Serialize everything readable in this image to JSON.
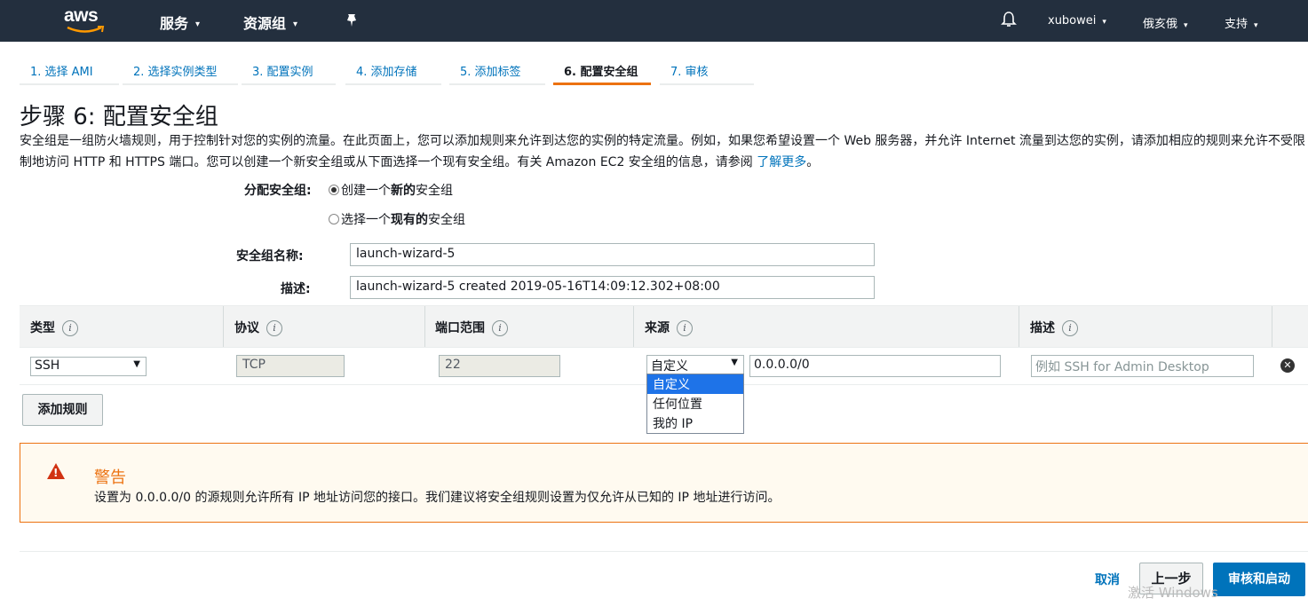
{
  "topnav": {
    "logo": "aws",
    "services": "服务",
    "resource_groups": "资源组",
    "user": "xubowei",
    "region": "俄亥俄",
    "support": "支持"
  },
  "tabs": [
    "1. 选择 AMI",
    "2. 选择实例类型",
    "3. 配置实例",
    "4. 添加存储",
    "5. 添加标签",
    "6. 配置安全组",
    "7. 审核"
  ],
  "active_tab": 5,
  "page": {
    "title": "步骤 6: 配置安全组",
    "description": "安全组是一组防火墙规则，用于控制针对您的实例的流量。在此页面上，您可以添加规则来允许到达您的实例的特定流量。例如，如果您希望设置一个 Web 服务器，并允许 Internet 流量到达您的实例，请添加相应的规则来允许不受限制地访问 HTTP 和 HTTPS 端口。您可以创建一个新安全组或从下面选择一个现有安全组。有关 Amazon EC2 安全组的信息，请参阅",
    "learn_more": "了解更多",
    "period": "。"
  },
  "form": {
    "assign_label": "分配安全组:",
    "option_new_prefix": "创建一个",
    "option_new_bold": "新的",
    "option_new_suffix": "安全组",
    "option_existing_prefix": "选择一个",
    "option_existing_bold": "现有的",
    "option_existing_suffix": "安全组",
    "name_label": "安全组名称:",
    "name_value": "launch-wizard-5",
    "desc_label": "描述:",
    "desc_value": "launch-wizard-5 created 2019-05-16T14:09:12.302+08:00"
  },
  "table": {
    "headers": [
      "类型",
      "协议",
      "端口范围",
      "来源",
      "描述"
    ],
    "info_glyph": "i",
    "row": {
      "type": "SSH",
      "protocol": "TCP",
      "port": "22",
      "source_type": "自定义",
      "source_value": "0.0.0.0/0",
      "desc_placeholder": "例如 SSH for Admin Desktop"
    },
    "source_options": [
      "自定义",
      "任何位置",
      "我的 IP"
    ]
  },
  "add_rule": "添加规则",
  "warning": {
    "title": "警告",
    "text": "设置为 0.0.0.0/0 的源规则允许所有 IP 地址访问您的接口。我们建议将安全组规则设置为仅允许从已知的 IP 地址进行访问。"
  },
  "footer": {
    "cancel": "取消",
    "previous": "上一步",
    "review_launch": "审核和启动"
  },
  "watermark": "激活 Windows",
  "colors": {
    "nav_bg": "#232f3e",
    "link": "#0073bb",
    "accent": "#ec7211",
    "primary_button": "#0073bb"
  }
}
